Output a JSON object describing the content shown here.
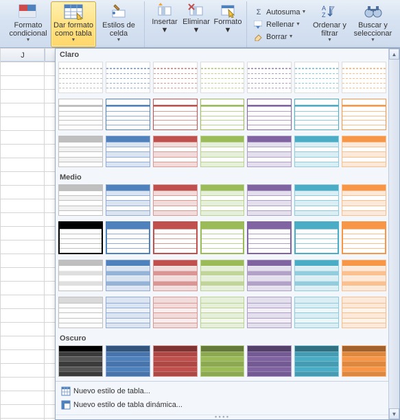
{
  "ribbon": {
    "conditional_formatting": "Formato condicional",
    "format_as_table": "Dar formato como tabla",
    "cell_styles": "Estilos de celda",
    "insert": "Insertar",
    "delete": "Eliminar",
    "format": "Formato",
    "autosum": "Autosuma",
    "fill": "Rellenar",
    "clear": "Borrar",
    "sort_filter": "Ordenar y filtrar",
    "find_select": "Buscar y seleccionar"
  },
  "sheet": {
    "column_letter": "J"
  },
  "gallery": {
    "sections": {
      "light": "Claro",
      "medium": "Medio",
      "dark": "Oscuro"
    },
    "footer": {
      "new_table_style": "Nuevo estilo de tabla...",
      "new_pivot_style": "Nuevo estilo de tabla dinámica..."
    },
    "palette": [
      {
        "name": "none",
        "header": "#bfbfbf",
        "body": "#ffffff",
        "alt": "#f2f2f2",
        "border": "#bfbfbf"
      },
      {
        "name": "blue",
        "header": "#4f81bd",
        "body": "#dbe5f1",
        "alt": "#ffffff",
        "border": "#8faad4"
      },
      {
        "name": "red",
        "header": "#c0504d",
        "body": "#f2dcdb",
        "alt": "#ffffff",
        "border": "#d89995"
      },
      {
        "name": "olive",
        "header": "#9bbb59",
        "body": "#e6efda",
        "alt": "#ffffff",
        "border": "#b9d191"
      },
      {
        "name": "purple",
        "header": "#8064a2",
        "body": "#e4dfec",
        "alt": "#ffffff",
        "border": "#ad9cc3"
      },
      {
        "name": "teal",
        "header": "#4bacc6",
        "body": "#dbeef3",
        "alt": "#ffffff",
        "border": "#8ecadb"
      },
      {
        "name": "orange",
        "header": "#f79646",
        "body": "#fde9d9",
        "alt": "#ffffff",
        "border": "#fabd8c"
      }
    ],
    "rows": {
      "light": [
        {
          "style": "plain_borderless"
        },
        {
          "style": "header_boxed"
        },
        {
          "style": "solid_header_banded"
        }
      ],
      "medium": [
        {
          "style": "solid_header_light_band"
        },
        {
          "style": "dark_header_thick_border"
        },
        {
          "style": "banded_mid"
        },
        {
          "style": "full_light_banded"
        }
      ],
      "dark": [
        {
          "style": "full_dark_rows"
        }
      ]
    }
  }
}
